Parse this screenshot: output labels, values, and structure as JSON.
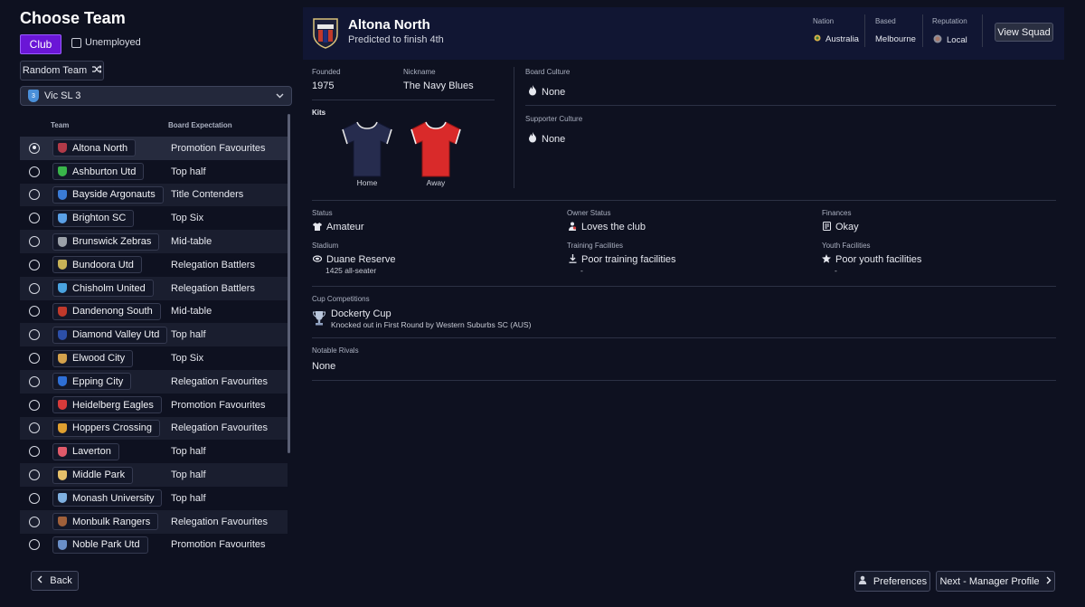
{
  "page": {
    "title": "Choose Team"
  },
  "filters": {
    "club_tab": "Club",
    "unemployed_label": "Unemployed",
    "random_team_label": "Random Team",
    "league": "Vic SL 3"
  },
  "columns": {
    "team": "Team",
    "board_expectation": "Board Expectation"
  },
  "teams": [
    {
      "name": "Altona North",
      "expectation": "Promotion Favourites",
      "crest": "#b23a48",
      "selected": true
    },
    {
      "name": "Ashburton Utd",
      "expectation": "Top half",
      "crest": "#39b54a"
    },
    {
      "name": "Bayside Argonauts",
      "expectation": "Title Contenders",
      "crest": "#3a7bd5"
    },
    {
      "name": "Brighton SC",
      "expectation": "Top Six",
      "crest": "#5aa0e6"
    },
    {
      "name": "Brunswick Zebras",
      "expectation": "Mid-table",
      "crest": "#9aa0a8"
    },
    {
      "name": "Bundoora Utd",
      "expectation": "Relegation Battlers",
      "crest": "#c7b257"
    },
    {
      "name": "Chisholm United",
      "expectation": "Relegation Battlers",
      "crest": "#4aa3df"
    },
    {
      "name": "Dandenong South",
      "expectation": "Mid-table",
      "crest": "#c0392b"
    },
    {
      "name": "Diamond Valley Utd",
      "expectation": "Top half",
      "crest": "#2c4fa8"
    },
    {
      "name": "Elwood City",
      "expectation": "Top Six",
      "crest": "#d4a24c"
    },
    {
      "name": "Epping City",
      "expectation": "Relegation Favourites",
      "crest": "#2e6fd6"
    },
    {
      "name": "Heidelberg Eagles",
      "expectation": "Promotion Favourites",
      "crest": "#d63a3a"
    },
    {
      "name": "Hoppers Crossing",
      "expectation": "Relegation Favourites",
      "crest": "#e0a030"
    },
    {
      "name": "Laverton",
      "expectation": "Top half",
      "crest": "#e05a6a"
    },
    {
      "name": "Middle Park",
      "expectation": "Top half",
      "crest": "#e6c06a"
    },
    {
      "name": "Monash University",
      "expectation": "Top half",
      "crest": "#7fb0e0"
    },
    {
      "name": "Monbulk Rangers",
      "expectation": "Relegation Favourites",
      "crest": "#a0603a"
    },
    {
      "name": "Noble Park Utd",
      "expectation": "Promotion Favourites",
      "crest": "#6a8fc8"
    }
  ],
  "club": {
    "name": "Altona North",
    "predicted": "Predicted to finish 4th",
    "nation_label": "Nation",
    "nation": "Australia",
    "based_label": "Based",
    "based": "Melbourne",
    "reputation_label": "Reputation",
    "reputation": "Local",
    "view_squad": "View Squad",
    "founded_label": "Founded",
    "founded": "1975",
    "nickname_label": "Nickname",
    "nickname": "The Navy Blues",
    "kits_label": "Kits",
    "kit_home": "Home",
    "kit_away": "Away",
    "board_culture_label": "Board Culture",
    "board_culture": "None",
    "supporter_culture_label": "Supporter Culture",
    "supporter_culture": "None",
    "status_label": "Status",
    "status": "Amateur",
    "owner_status_label": "Owner Status",
    "owner_status": "Loves the club",
    "finances_label": "Finances",
    "finances": "Okay",
    "stadium_label": "Stadium",
    "stadium": "Duane Reserve",
    "stadium_capacity": "1425 all-seater",
    "training_label": "Training Facilities",
    "training": "Poor training facilities",
    "training_sub": "-",
    "youth_label": "Youth Facilities",
    "youth": "Poor youth facilities",
    "youth_sub": "-",
    "cup_label": "Cup Competitions",
    "cup_name": "Dockerty Cup",
    "cup_result": "Knocked out in First Round by Western Suburbs SC (AUS)",
    "rivals_label": "Notable Rivals",
    "rivals": "None"
  },
  "footer": {
    "back": "Back",
    "preferences": "Preferences",
    "next": "Next - Manager Profile"
  }
}
